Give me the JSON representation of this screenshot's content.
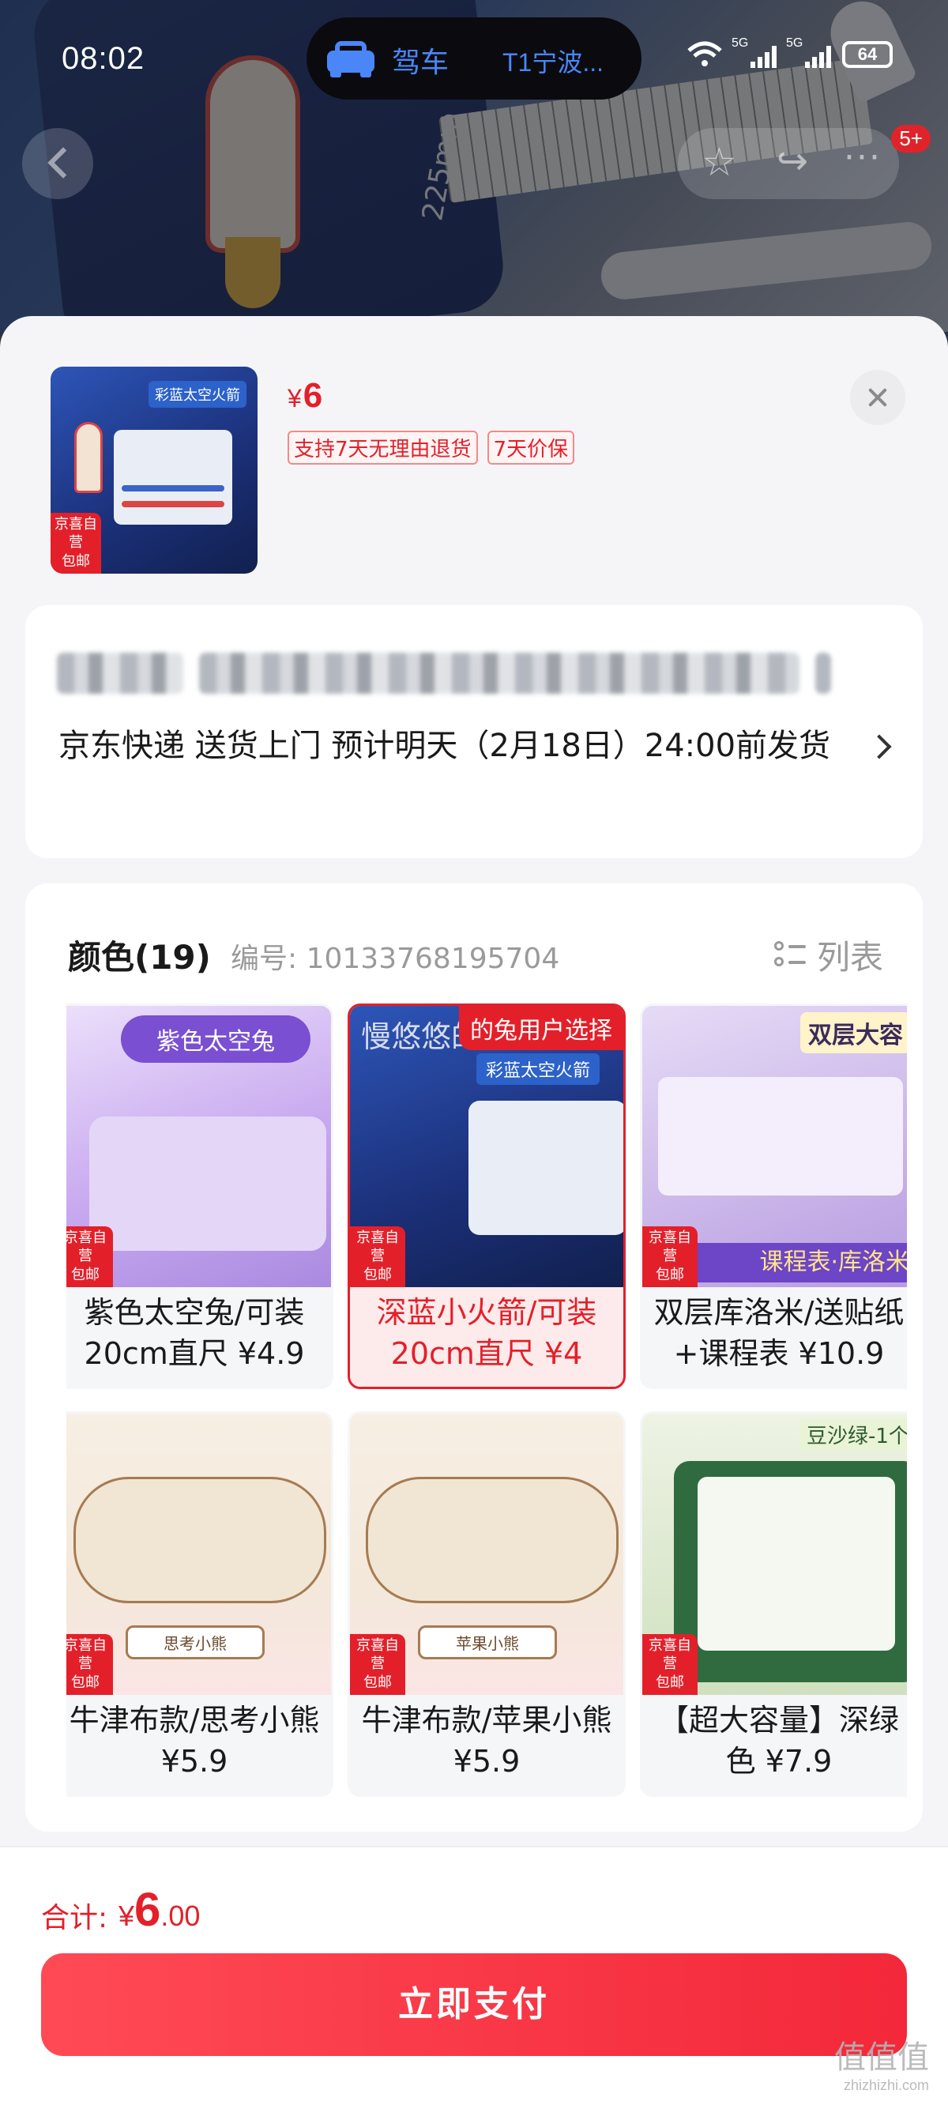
{
  "status_bar": {
    "time": "08:02",
    "drive_label": "驾车",
    "drive_destination": "T1宁波...",
    "signal_1_label": "5G",
    "signal_2_label": "5G",
    "battery": "64"
  },
  "nav": {
    "badge": "5+",
    "ruler_text": "225mm"
  },
  "summary": {
    "currency": "¥",
    "price": "6",
    "thumb_tag": "彩蓝太空火箭",
    "thumb_badge": [
      "京喜自营",
      "包邮"
    ],
    "tags": [
      "支持7天无理由退货",
      "7天价保"
    ]
  },
  "delivery": {
    "text": "京东快递 送货上门 预计明天（2月18日）24:00前发货"
  },
  "variants": {
    "title": "颜色(19)",
    "code": "编号: 10133768195704",
    "list_label": "列表",
    "badge_line1": "京喜自营",
    "badge_line2": "包邮",
    "items": [
      {
        "label": "紫色太空兔/可装20cm直尺 ¥4.9",
        "img_title": "紫色太空兔",
        "selected": false
      },
      {
        "label": "深蓝小火箭/可装20cm直尺 ¥4",
        "img_title": "彩蓝太空火箭",
        "selected": true,
        "corner": "的兔用户选择",
        "overlay": "慢悠悠的兔子"
      },
      {
        "label": "双层库洛米/送贴纸+课程表 ¥10.9",
        "img_title": "双层大容",
        "strip": "课程表·库洛米",
        "selected": false
      },
      {
        "label": "牛津布款/思考小熊 ¥5.9",
        "img_title": "思考小熊",
        "selected": false
      },
      {
        "label": "牛津布款/苹果小熊 ¥5.9",
        "img_title": "苹果小熊",
        "selected": false
      },
      {
        "label": "【超大容量】深绿色 ¥7.9",
        "img_title": "豆沙绿-1个",
        "selected": false
      }
    ]
  },
  "footer": {
    "total_label": "合计:",
    "currency": "¥",
    "total_int": "6",
    "total_dec": ".00",
    "pay_button": "立即支付"
  },
  "watermark": {
    "line1": "值值值",
    "line2": "zhizhizhi.com"
  },
  "colors": {
    "accent": "#e3202a",
    "drive_blue": "#4a86f7",
    "pay_gradient_start": "#ff4a55",
    "pay_gradient_end": "#f3283a"
  }
}
